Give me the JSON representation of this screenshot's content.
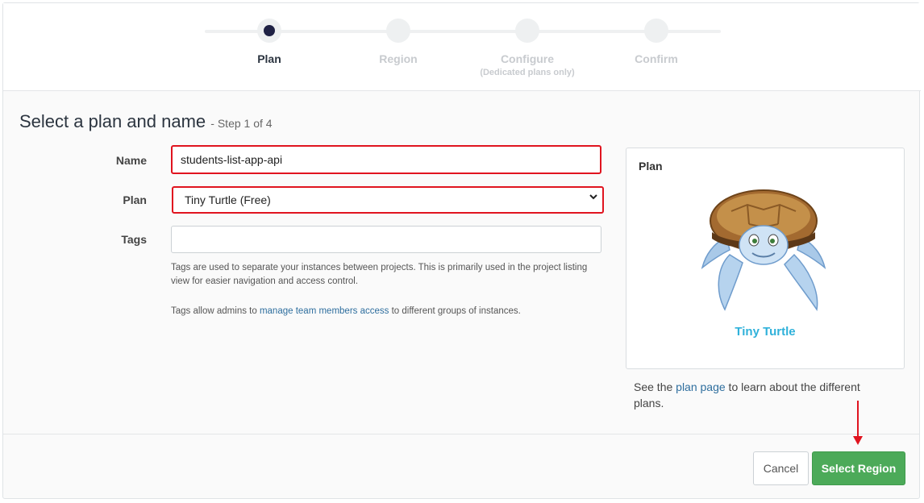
{
  "steps": [
    {
      "label": "Plan",
      "sub": ""
    },
    {
      "label": "Region",
      "sub": ""
    },
    {
      "label": "Configure",
      "sub": "(Dedicated plans only)"
    },
    {
      "label": "Confirm",
      "sub": ""
    }
  ],
  "header": {
    "title": "Select a plan and name",
    "step_text": "- Step 1 of 4"
  },
  "form": {
    "name_label": "Name",
    "name_value": "students-list-app-api",
    "plan_label": "Plan",
    "plan_value": "Tiny Turtle (Free)",
    "tags_label": "Tags",
    "tags_value": "",
    "help1": "Tags are used to separate your instances between projects. This is primarily used in the project listing view for easier navigation and access control.",
    "help2_prefix": "Tags allow admins to ",
    "help2_link": "manage team members access",
    "help2_suffix": " to different groups of instances."
  },
  "plan_card": {
    "title": "Plan",
    "plan_name": "Tiny Turtle",
    "mascot_icon": "turtle-icon"
  },
  "plan_note": {
    "prefix": "See the ",
    "link": "plan page",
    "suffix": " to learn about the different plans."
  },
  "buttons": {
    "cancel": "Cancel",
    "next": "Select Region"
  },
  "colors": {
    "primary_button": "#4caa59",
    "highlight": "#e0141f",
    "accent_text": "#2fb1da"
  }
}
